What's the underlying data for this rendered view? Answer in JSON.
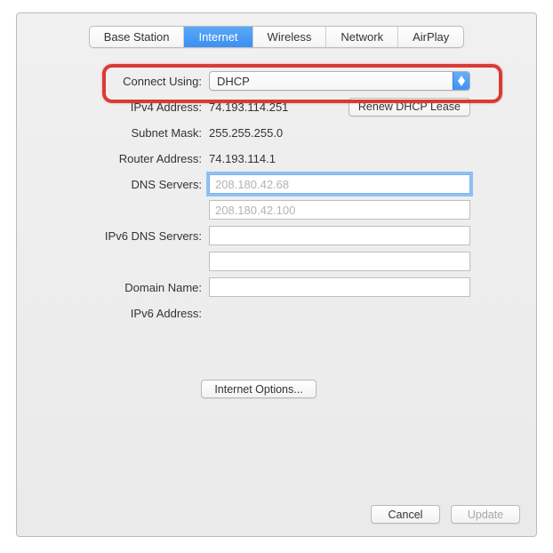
{
  "tabs": {
    "base_station": "Base Station",
    "internet": "Internet",
    "wireless": "Wireless",
    "network": "Network",
    "airplay": "AirPlay",
    "active": "internet"
  },
  "form": {
    "connect_using_label": "Connect Using:",
    "connect_using_value": "DHCP",
    "ipv4_addr_label": "IPv4 Address:",
    "ipv4_addr_value": "74.193.114.251",
    "renew_label": "Renew DHCP Lease",
    "subnet_label": "Subnet Mask:",
    "subnet_value": "255.255.255.0",
    "router_label": "Router Address:",
    "router_value": "74.193.114.1",
    "dns_label": "DNS Servers:",
    "dns1_placeholder": "208.180.42.68",
    "dns2_placeholder": "208.180.42.100",
    "ipv6_dns_label": "IPv6 DNS Servers:",
    "domain_label": "Domain Name:",
    "ipv6_addr_label": "IPv6 Address:",
    "options_label": "Internet Options..."
  },
  "footer": {
    "cancel": "Cancel",
    "update": "Update"
  }
}
